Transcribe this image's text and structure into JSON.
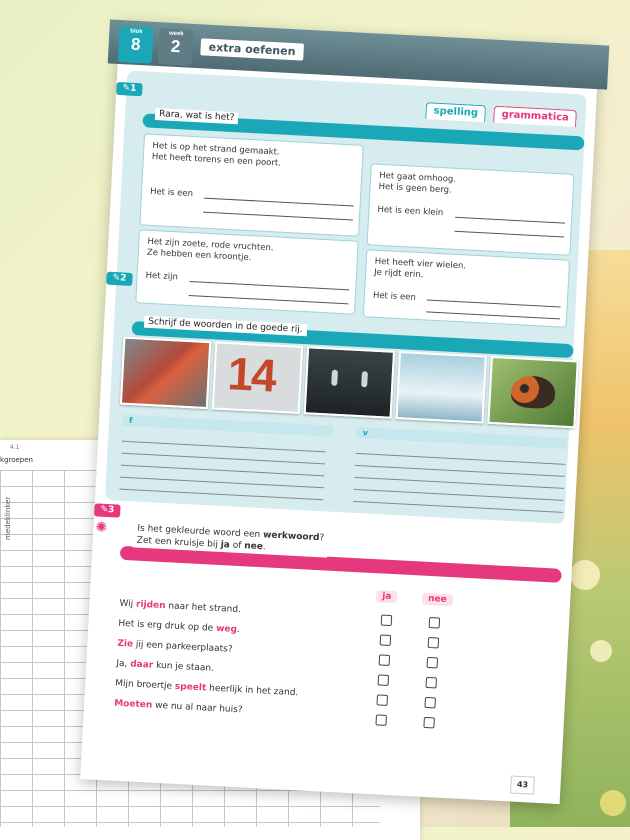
{
  "header": {
    "blok_label": "blok",
    "blok_num": "8",
    "week_label": "week",
    "week_num": "2",
    "title": "extra oefenen"
  },
  "tags": {
    "spelling": "spelling",
    "grammatica": "grammatica"
  },
  "back_page": {
    "tab_label": "4.1",
    "col_header": "kgroepen",
    "row_label": "medeklinker"
  },
  "ex1": {
    "number": "1",
    "title": "Rara, wat is het?",
    "riddles": [
      {
        "text": "Het is op het strand gemaakt.\nHet heeft torens en een poort.",
        "answer_prefix": "Het is een"
      },
      {
        "text": "Het gaat omhoog.\nHet is geen berg.",
        "answer_prefix": "Het is een klein"
      },
      {
        "text": "Het zijn zoete, rode vruchten.\nZe hebben een kroontje.",
        "answer_prefix": "Het zijn"
      },
      {
        "text": "Het heeft vier wielen.\nJe rijdt erin.",
        "answer_prefix": "Het is een"
      }
    ]
  },
  "ex2": {
    "number": "2",
    "title": "Schrijf de woorden in de goede rij.",
    "photo_number": "14",
    "col_f": "f",
    "col_v": "v"
  },
  "ex3": {
    "number": "3",
    "instruction_line1": "Is het gekleurde woord een ",
    "instruction_bold1": "werkwoord",
    "instruction_tail1": "?",
    "instruction_line2a": "Zet een kruisje bij ",
    "instruction_ja": "ja",
    "instruction_of": " of ",
    "instruction_nee": "nee",
    "instruction_dot": ".",
    "col_ja": "ja",
    "col_nee": "nee",
    "rows": [
      {
        "before": "Wij ",
        "word": "rijden",
        "after": " naar het strand."
      },
      {
        "before": "Het is erg druk op de ",
        "word": "weg",
        "after": "."
      },
      {
        "before": "",
        "word": "Zie",
        "after": " jij een parkeerplaats?"
      },
      {
        "before": "Ja, ",
        "word": "daar",
        "after": " kun je staan."
      },
      {
        "before": "Mijn broertje ",
        "word": "speelt",
        "after": " heerlijk in het zand."
      },
      {
        "before": "",
        "word": "Moeten",
        "after": " we nu al naar huis?"
      }
    ]
  },
  "page_number": "43"
}
